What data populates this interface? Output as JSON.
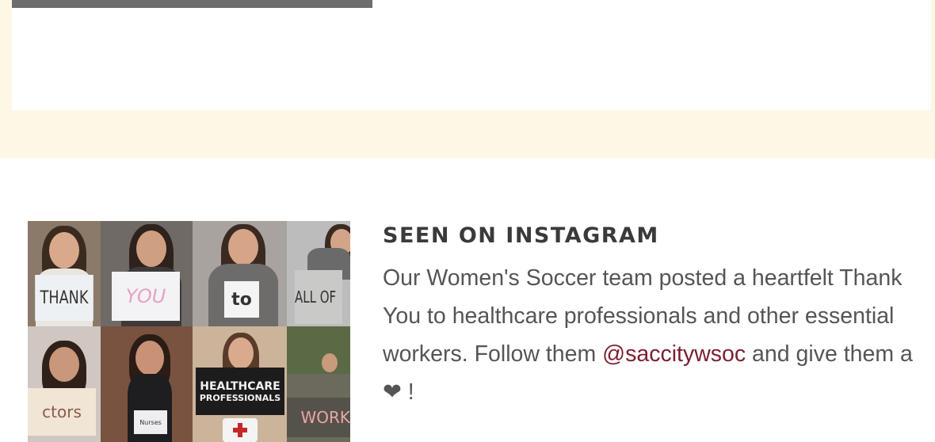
{
  "instagram": {
    "heading": "SEEN ON INSTAGRAM",
    "text_before": "Our Women's Soccer team posted a heartfelt Thank You to healthcare professionals and other essential workers. Follow them ",
    "handle": "@saccitywsoc",
    "text_after": " and give them a ",
    "heart": "❤",
    "text_end": " !",
    "photo_signs": {
      "thank": "THANK",
      "you": "YOU",
      "to": "to",
      "all_of": "ALL OF",
      "healthcare": "HEALTHCARE",
      "professionals": "PROFESSIONALS",
      "doctors": "ctors",
      "nurses": "Nurses",
      "workers": "WORK"
    }
  },
  "colors": {
    "band": "#fdf7e6",
    "link": "#7b1f2f",
    "heading": "#3a3a3a",
    "body_text": "#555555"
  }
}
